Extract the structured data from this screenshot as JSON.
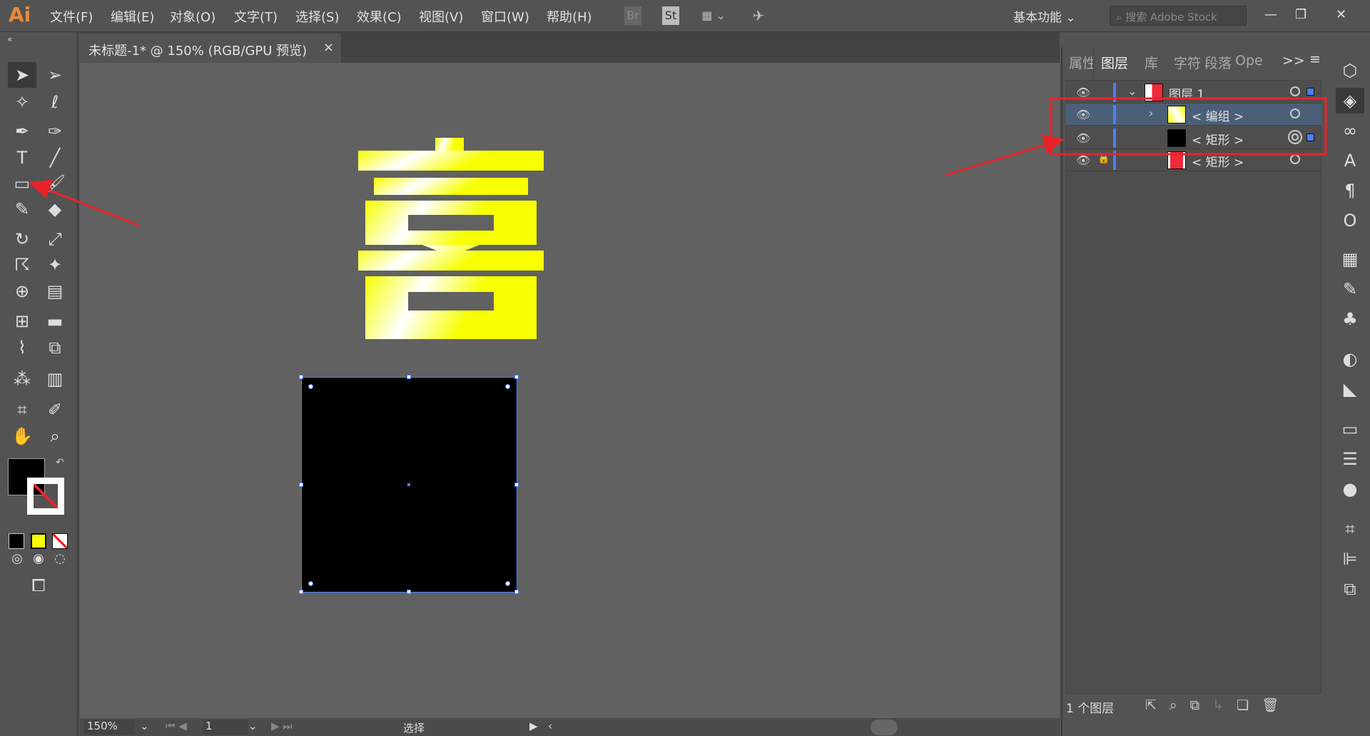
{
  "app": {
    "logo": "Ai"
  },
  "menu": [
    "文件(F)",
    "编辑(E)",
    "对象(O)",
    "文字(T)",
    "选择(S)",
    "效果(C)",
    "视图(V)",
    "窗口(W)",
    "帮助(H)"
  ],
  "menu_buttons": {
    "bridge": "Br",
    "stock": "St"
  },
  "workspace": "基本功能",
  "search": {
    "placeholder": "搜索 Adobe Stock"
  },
  "document_tab": {
    "title": "未标题-1* @ 150% (RGB/GPU 预览)",
    "close": "×"
  },
  "artwork": {
    "character": "喜",
    "gradient": [
      "#ffffff",
      "#f7ff00"
    ],
    "rect_fill": "#000000",
    "selection_color": "#4a7fff"
  },
  "panel": {
    "tabs": [
      "属性",
      "图层",
      "库",
      "字符",
      "段落",
      "Ope"
    ],
    "active_tab": "图层",
    "overflow": ">>",
    "layers": [
      {
        "name": "图层 1",
        "level": 0,
        "expanded": true,
        "thumb": "#ee2a3c",
        "visible": true,
        "locked": false,
        "selected_marker": true
      },
      {
        "name": "< 编组 >",
        "level": 1,
        "expandable": true,
        "thumb": "#f7ff00",
        "visible": true,
        "locked": false,
        "highlighted": true
      },
      {
        "name": "< 矩形 >",
        "level": 1,
        "thumb": "#000000",
        "visible": true,
        "locked": false,
        "targeted": true,
        "selected_marker": true
      },
      {
        "name": "< 矩形 >",
        "level": 1,
        "thumb": "#ee2a3c",
        "visible": true,
        "locked": true
      }
    ],
    "footer": "1 个图层"
  },
  "status": {
    "zoom": "150%",
    "artboard": "1",
    "tool": "选择"
  },
  "annotation_color": "#e8232a",
  "toolbar": {
    "fill": "#000000",
    "stroke": "none"
  }
}
